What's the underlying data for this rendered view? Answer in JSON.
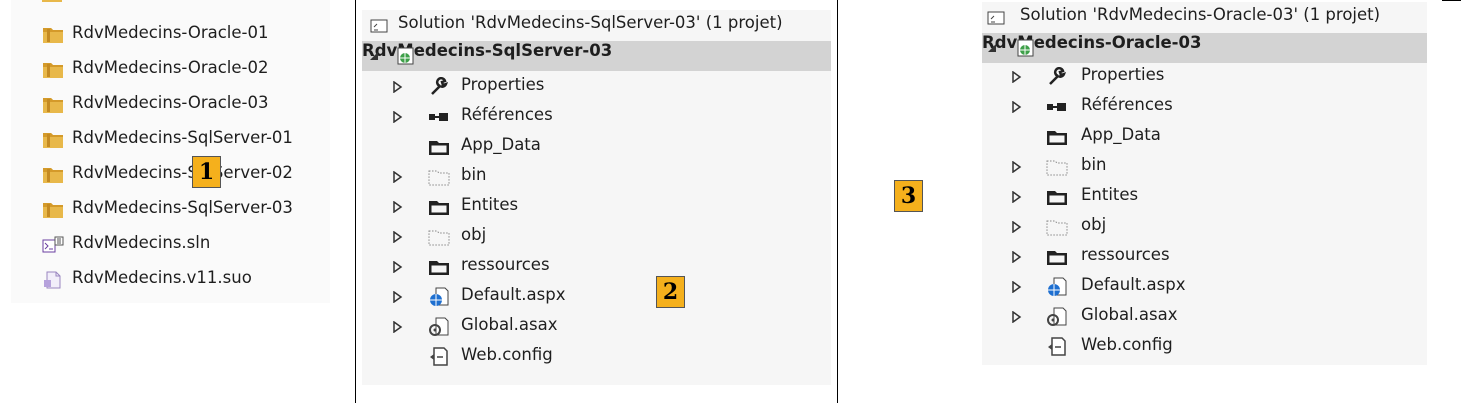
{
  "explorer": {
    "items": [
      {
        "label": "RdvMedecins-Oracle-01",
        "icon": "folder-icon"
      },
      {
        "label": "RdvMedecins-Oracle-02",
        "icon": "folder-icon"
      },
      {
        "label": "RdvMedecins-Oracle-03",
        "icon": "folder-icon"
      },
      {
        "label": "RdvMedecins-SqlServer-01",
        "icon": "folder-icon"
      },
      {
        "label": "RdvMedecins-SqlServer-02",
        "icon": "folder-icon"
      },
      {
        "label": "RdvMedecins-SqlServer-03",
        "icon": "folder-icon"
      },
      {
        "label": "RdvMedecins.sln",
        "icon": "solution-file-icon"
      },
      {
        "label": "RdvMedecins.v11.suo",
        "icon": "suo-file-icon"
      }
    ]
  },
  "solex1": {
    "solution_label": "Solution 'RdvMedecins-SqlServer-03' (1 projet)",
    "project_label": "RdvMedecins-SqlServer-03",
    "nodes": [
      {
        "label": "Properties",
        "icon": "wrench-icon",
        "expandable": true
      },
      {
        "label": "Références",
        "icon": "references-icon",
        "expandable": true
      },
      {
        "label": "App_Data",
        "icon": "folder-icon",
        "expandable": false
      },
      {
        "label": "bin",
        "icon": "dotted-folder-icon",
        "expandable": true
      },
      {
        "label": "Entites",
        "icon": "folder-icon",
        "expandable": true
      },
      {
        "label": "obj",
        "icon": "dotted-folder-icon",
        "expandable": true
      },
      {
        "label": "ressources",
        "icon": "folder-icon",
        "expandable": true
      },
      {
        "label": "Default.aspx",
        "icon": "aspx-page-icon",
        "expandable": true
      },
      {
        "label": "Global.asax",
        "icon": "asax-gear-icon",
        "expandable": true
      },
      {
        "label": "Web.config",
        "icon": "config-file-icon",
        "expandable": false
      }
    ]
  },
  "solex2": {
    "solution_label": "Solution 'RdvMedecins-Oracle-03' (1 projet)",
    "project_label": "RdvMedecins-Oracle-03",
    "nodes": [
      {
        "label": "Properties",
        "icon": "wrench-icon",
        "expandable": true
      },
      {
        "label": "Références",
        "icon": "references-icon",
        "expandable": true
      },
      {
        "label": "App_Data",
        "icon": "folder-icon",
        "expandable": false
      },
      {
        "label": "bin",
        "icon": "dotted-folder-icon",
        "expandable": true
      },
      {
        "label": "Entites",
        "icon": "folder-icon",
        "expandable": true
      },
      {
        "label": "obj",
        "icon": "dotted-folder-icon",
        "expandable": true
      },
      {
        "label": "ressources",
        "icon": "folder-icon",
        "expandable": true
      },
      {
        "label": "Default.aspx",
        "icon": "aspx-page-icon",
        "expandable": true
      },
      {
        "label": "Global.asax",
        "icon": "asax-gear-icon",
        "expandable": true
      },
      {
        "label": "Web.config",
        "icon": "config-file-icon",
        "expandable": false
      }
    ]
  },
  "markers": {
    "one": "1",
    "two": "2",
    "three": "3"
  },
  "colors": {
    "marker_fill": "#f5b01c",
    "selected_row": "#d3d3d3",
    "folder_yellow": "#e8b84a"
  }
}
